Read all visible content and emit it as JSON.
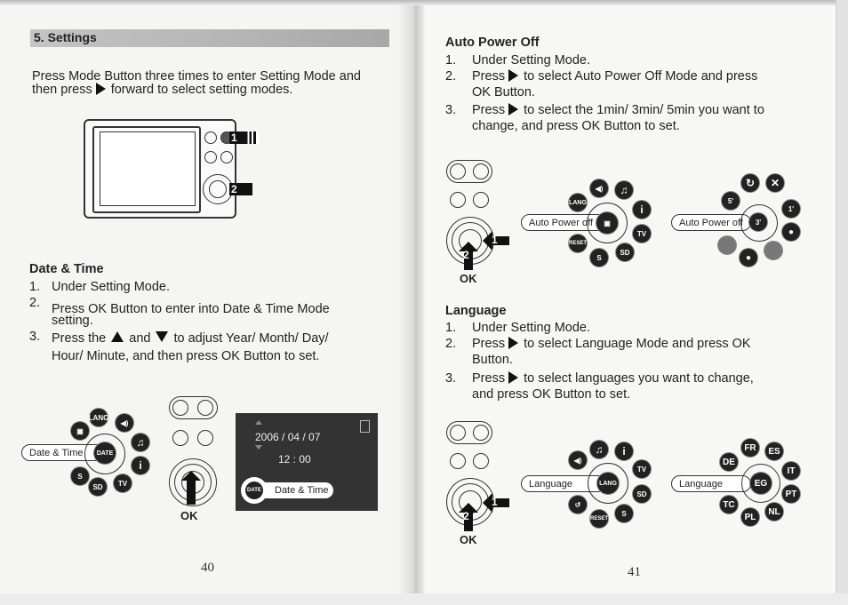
{
  "left_page": {
    "section_title": "5.   Settings",
    "intro_line1": "Press Mode Button three times to enter Setting Mode and",
    "intro_line2_pre": "then press",
    "intro_line2_post": "forward to select setting modes.",
    "camera_callouts": [
      "1",
      "2"
    ],
    "date_time": {
      "heading": "Date & Time",
      "steps": [
        {
          "num": "1.",
          "text": "Under Setting Mode."
        },
        {
          "num": "2.",
          "line1": "Press OK Button to enter into Date & Time Mode",
          "line2": "setting."
        },
        {
          "num": "3.",
          "pre": "Press the",
          "mid": "and",
          "post": "to adjust Year/ Month/ Day/",
          "line2": "Hour/ Minute, and then press OK Button to set."
        }
      ],
      "menu_label": "Date & Time",
      "menu_icons": [
        "LANG",
        "DATE",
        "sound-icon",
        "music-icon",
        "info-icon",
        "tv-icon",
        "sd-format-icon",
        "tv-s-icon",
        "auto-power-icon"
      ],
      "center_icon": "DATE",
      "ok_label": "OK",
      "screen": {
        "date": "2006 / 04 / 07",
        "time": "12 : 00",
        "badge": "DATE",
        "label": "Date & Time"
      }
    },
    "page_number": "40"
  },
  "right_page": {
    "auto_power_off": {
      "heading": "Auto Power Off",
      "steps": [
        {
          "num": "1.",
          "text": "Under Setting Mode."
        },
        {
          "num": "2.",
          "pre": "Press",
          "post": "to select Auto Power Off Mode and press",
          "line2": "OK Button."
        },
        {
          "num": "3.",
          "pre": "Press",
          "post": "to select the 1min/ 3min/ 5min you want to",
          "line2": "change, and press OK Button to set."
        }
      ],
      "callouts": [
        "1",
        "2"
      ],
      "ok_label": "OK",
      "menu_label": "Auto Power off",
      "menu_icons": [
        "LANG",
        "RESET",
        "sound-icon",
        "music-icon",
        "info-icon",
        "tv-icon",
        "sd-format-icon",
        "tv-s-icon"
      ],
      "submenu_label": "Auto Power off",
      "submenu_options": [
        "5'",
        "3'",
        "1'"
      ]
    },
    "language": {
      "heading": "Language",
      "steps": [
        {
          "num": "1.",
          "text": "Under Setting Mode."
        },
        {
          "num": "2.",
          "pre": "Press",
          "post": "to select Language Mode and press OK",
          "line2": "Button."
        },
        {
          "num": "3.",
          "pre": "Press",
          "post": "to select languages you want to change,",
          "line2": "and press OK Button to set."
        }
      ],
      "callouts": [
        "1",
        "2"
      ],
      "ok_label": "OK",
      "menu_label": "Language",
      "menu_icons": [
        "LANG",
        "RESET",
        "sound-icon",
        "music-icon",
        "info-icon",
        "tv-icon",
        "sd-format-icon",
        "tv-s-icon",
        "no-rotate-icon"
      ],
      "submenu_label": "Language",
      "submenu_center": "EG",
      "languages": [
        "DE",
        "FR",
        "ES",
        "IT",
        "PT",
        "NL",
        "PL",
        "TC"
      ]
    },
    "page_number": "41"
  }
}
